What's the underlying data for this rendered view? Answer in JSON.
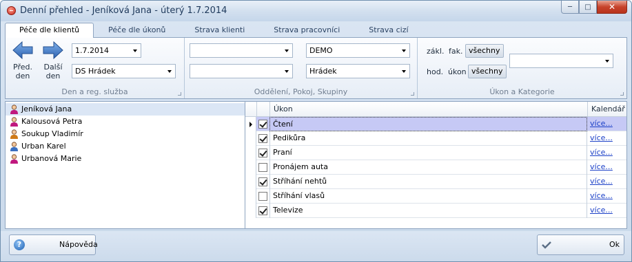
{
  "window": {
    "title": "Denní přehled - Jeníková Jana - úterý 1.7.2014",
    "controls": {
      "minimize": "─",
      "maximize": "□",
      "close": "✕"
    }
  },
  "tabs": [
    {
      "label": "Péče dle klientů",
      "active": true
    },
    {
      "label": "Péče dle úkonů",
      "active": false
    },
    {
      "label": "Strava klienti",
      "active": false
    },
    {
      "label": "Strava pracovníci",
      "active": false
    },
    {
      "label": "Strava cizí",
      "active": false
    }
  ],
  "ribbon": {
    "group1": {
      "prev_label_1": "Před.",
      "prev_label_2": "den",
      "next_label_1": "Další",
      "next_label_2": "den",
      "date_value": "1.7.2014",
      "service_value": "DS Hrádek",
      "caption": "Den a reg. služba"
    },
    "group2": {
      "combo1_value": "",
      "combo2_value": "",
      "combo3_value": "DEMO",
      "combo4_value": "Hrádek",
      "caption": "Oddělení, Pokoj, Skupiny"
    },
    "group3": {
      "label_zakl": "zákl.",
      "label_fak": "fak.",
      "toggle_vsechny_1": "všechny",
      "label_hod": "hod.",
      "label_ukon": "úkon",
      "toggle_vsechny_2": "všechny",
      "category_value": "",
      "caption": "Úkon a Kategorie"
    }
  },
  "clients": [
    {
      "name": "Jeníková Jana",
      "gender": "female",
      "selected": true
    },
    {
      "name": "Kalousová Petra",
      "gender": "female",
      "selected": false
    },
    {
      "name": "Soukup Vladimír",
      "gender": "male",
      "selected": false
    },
    {
      "name": "Urban Karel",
      "gender": "male",
      "selected": false
    },
    {
      "name": "Urbanová Marie",
      "gender": "female",
      "selected": false
    }
  ],
  "grid": {
    "columns": {
      "ukon": "Úkon",
      "kalendar": "Kalendář"
    },
    "rows": [
      {
        "checked": true,
        "ukon": "Čtení",
        "link": "více...",
        "selected": true
      },
      {
        "checked": true,
        "ukon": "Pedikůra",
        "link": "více...",
        "selected": false
      },
      {
        "checked": true,
        "ukon": "Praní",
        "link": "více...",
        "selected": false
      },
      {
        "checked": false,
        "ukon": "Pronájem auta",
        "link": "více...",
        "selected": false
      },
      {
        "checked": true,
        "ukon": "Stříhání nehtů",
        "link": "více...",
        "selected": false
      },
      {
        "checked": false,
        "ukon": "Stříhání vlasů",
        "link": "více...",
        "selected": false
      },
      {
        "checked": true,
        "ukon": "Televize",
        "link": "více...",
        "selected": false
      }
    ]
  },
  "footer": {
    "help_label": "Nápověda",
    "ok_label": "Ok"
  },
  "colors": {
    "selected_row": "#c6c9f5",
    "link": "#1a3fc7",
    "arrow_blue": "#3d78c8",
    "female_icon": "#c0197e",
    "male_icon": "#d07a18"
  }
}
